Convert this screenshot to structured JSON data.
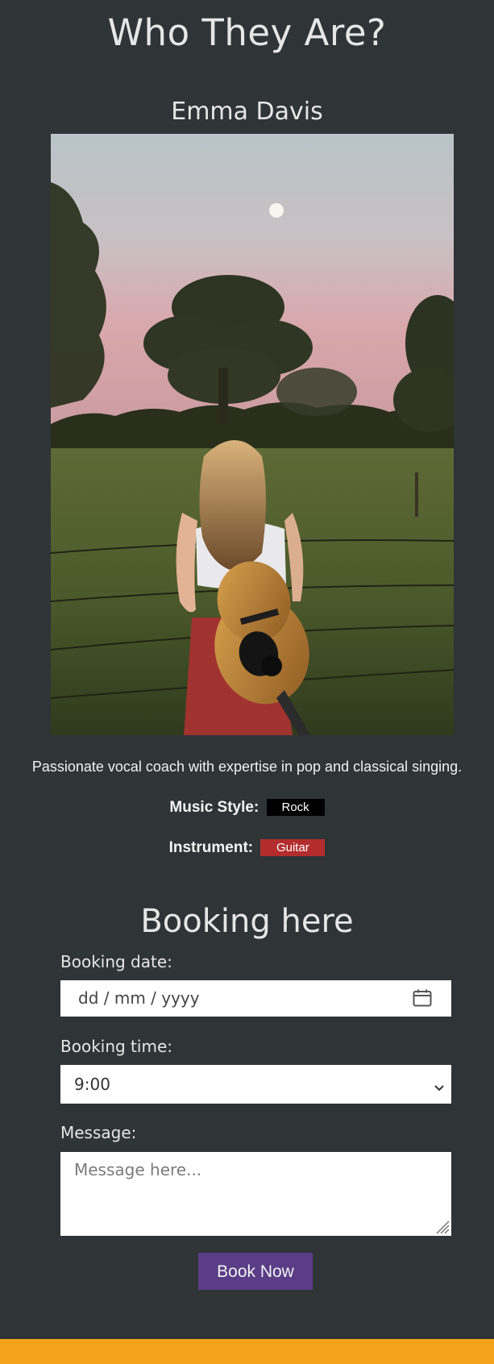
{
  "page": {
    "title": "Who They Are?"
  },
  "artist": {
    "name": "Emma Davis",
    "photo_icon": "photo-woman-with-guitar",
    "bio": "Passionate vocal coach with expertise in pop and classical singing.",
    "music_style_label": "Music Style:",
    "music_style_value": "Rock",
    "instrument_label": "Instrument:",
    "instrument_value": "Guitar"
  },
  "booking": {
    "title": "Booking here",
    "date_label": "Booking date:",
    "date_placeholder": "dd / mm / yyyy",
    "time_label": "Booking time:",
    "time_value": "9:00",
    "message_label": "Message:",
    "message_placeholder": "Message here...",
    "submit_label": "Book Now"
  },
  "colors": {
    "background": "#2f3437",
    "button": "#5a3d86",
    "footer": "#f5a21b",
    "style_tag": "#000000",
    "instrument_tag": "#b32d2e"
  }
}
